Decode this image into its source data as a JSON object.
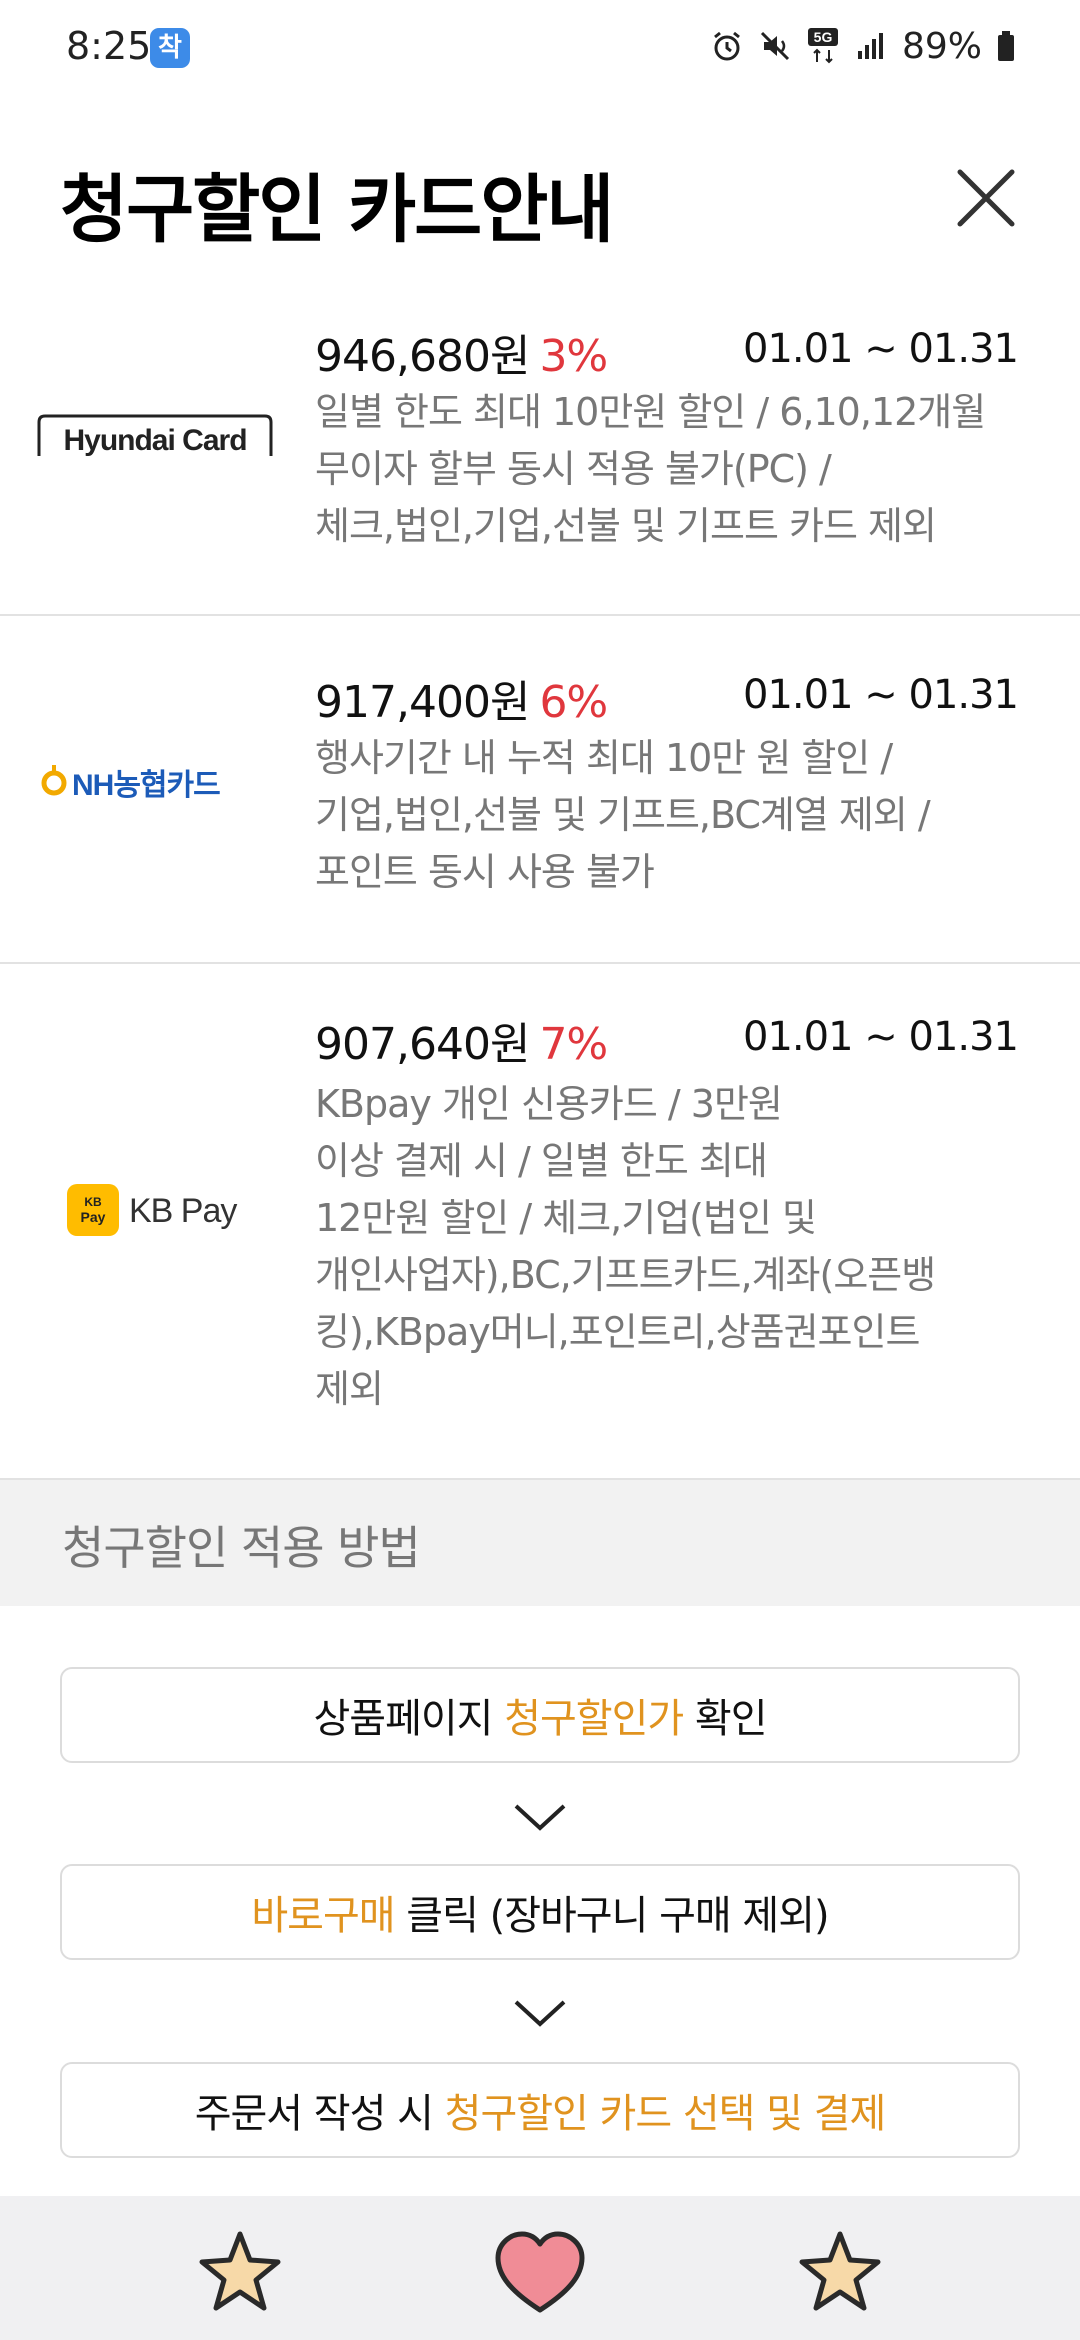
{
  "status_bar": {
    "time": "8:25",
    "app_icon_label": "착",
    "network": "5G",
    "battery": "89%"
  },
  "header": {
    "title": "청구할인 카드안내",
    "close_icon": "close-icon"
  },
  "cards": [
    {
      "logo_text": "Hyundai Card",
      "price": "946,680원",
      "rate": "3%",
      "period": "01.01 ~ 01.31",
      "description": "일별 한도 최대 10만원 할인 / 6,10,12개월\n무이자 할부 동시 적용 불가(PC) /\n체크,법인,기업,선불 및 기프트 카드 제외"
    },
    {
      "logo_text": "NH농협카드",
      "price": "917,400원",
      "rate": "6%",
      "period": "01.01 ~ 01.31",
      "description": "행사기간 내 누적 최대 10만 원 할인 /\n기업,법인,선불 및 기프트,BC계열 제외 /\n포인트 동시 사용 불가"
    },
    {
      "logo_text": "KB Pay",
      "logo_badge_text": "KB Pay",
      "price": "907,640원",
      "rate": "7%",
      "period": "01.01 ~ 01.31",
      "description": "KBpay 개인 신용카드 / 3만원\n이상 결제 시 / 일별 한도 최대\n12만원 할인 / 체크,기업(법인 및\n개인사업자),BC,기프트카드,계좌(오픈뱅\n킹),KBpay머니,포인트리,상품권포인트\n제외"
    }
  ],
  "section": {
    "title": "청구할인 적용 방법"
  },
  "steps": [
    {
      "pre": "상품페이지 ",
      "highlight": "청구할인가",
      "post": " 확인"
    },
    {
      "pre": "",
      "highlight": "바로구매",
      "post": " 클릭 (장바구니 구매 제외)"
    },
    {
      "pre": "주문서 작성 시 ",
      "highlight": "청구할인 카드 선택 및 결제",
      "post": ""
    }
  ],
  "bottom_bar": {
    "icons": [
      "star-icon",
      "heart-icon",
      "star-icon"
    ]
  },
  "colors": {
    "rate": "#e0373d",
    "highlight": "#e0931f",
    "muted_text": "#777777",
    "section_bg": "#f2f2f2"
  }
}
